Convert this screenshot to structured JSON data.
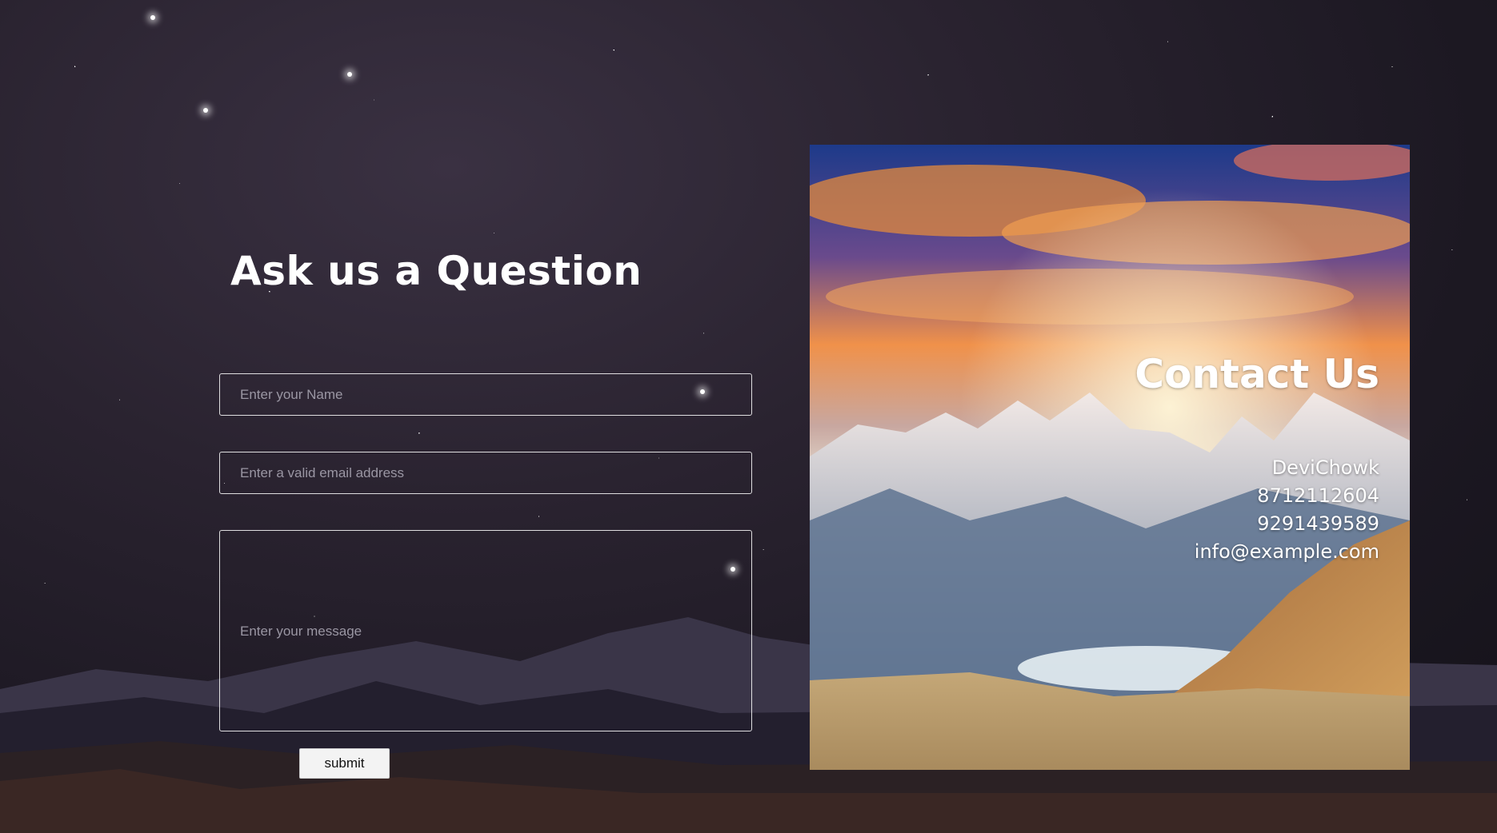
{
  "form": {
    "heading": "Ask us a Question",
    "name_placeholder": "Enter your Name",
    "email_placeholder": "Enter a valid email address",
    "message_placeholder": "Enter your message",
    "submit_label": "submit"
  },
  "contact": {
    "title": "Contact Us",
    "name": "DeviChowk",
    "phone_1": "8712112604",
    "phone_2": "9291439589",
    "email": "info@example.com"
  }
}
